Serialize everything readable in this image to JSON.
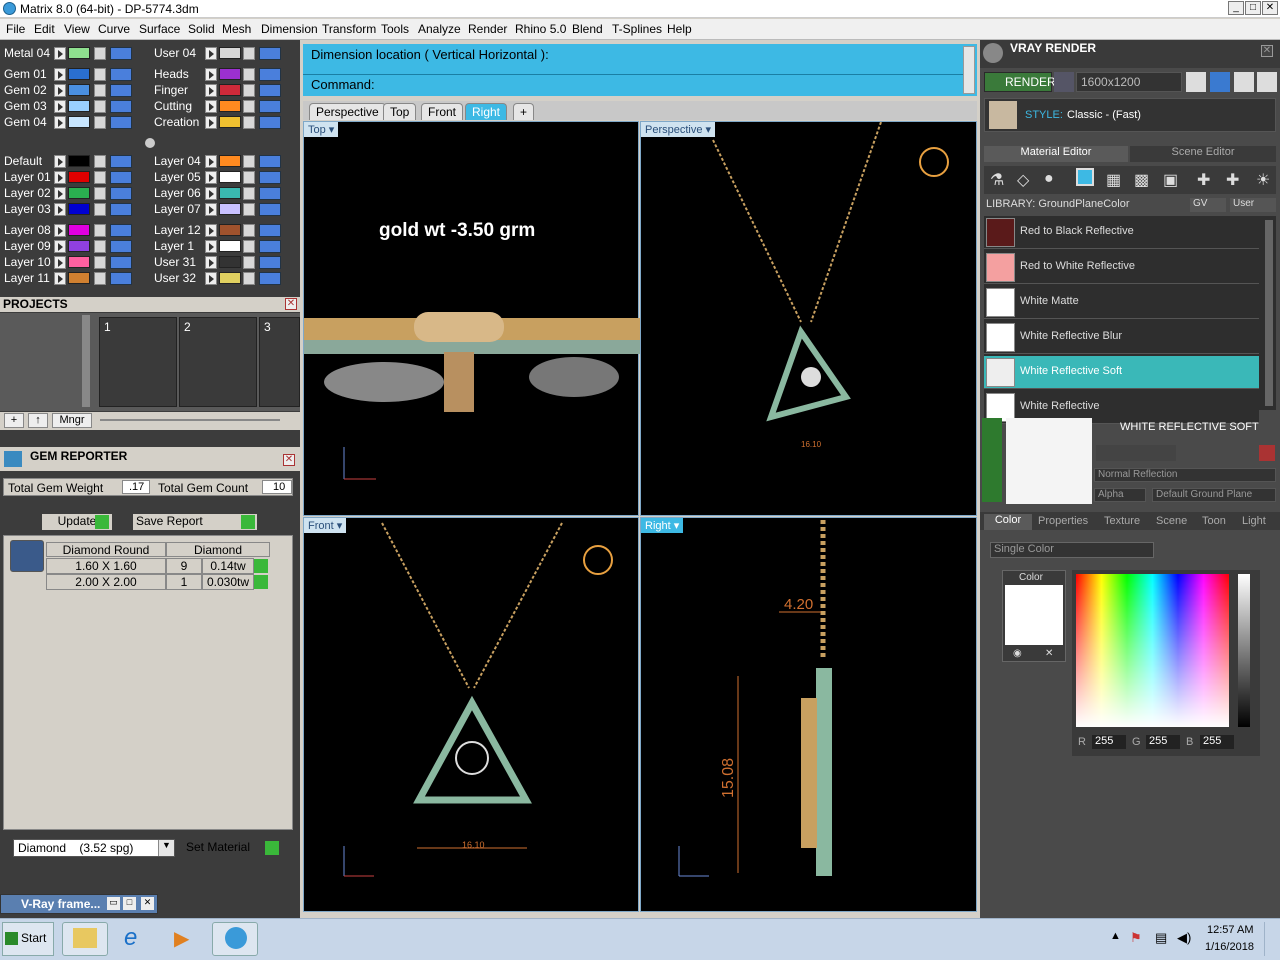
{
  "window": {
    "title": "Matrix 8.0 (64-bit) - DP-5774.3dm"
  },
  "menu": [
    "File",
    "Edit",
    "View",
    "Curve",
    "Surface",
    "Solid",
    "Mesh",
    "Dimension",
    "Transform",
    "Tools",
    "Analyze",
    "Render",
    "Rhino 5.0",
    "Blend",
    "T-Splines",
    "Help"
  ],
  "layers_top": [
    {
      "name": "Metal 04",
      "color": "#8fe08f",
      "name2": "User 04",
      "color2": "#d8d8d8"
    },
    {
      "name": "Gem 01",
      "color": "#2a6fd0",
      "name2": "Heads",
      "color2": "#9b30d0"
    },
    {
      "name": "Gem 02",
      "color": "#4a8fe0",
      "name2": "Finger",
      "color2": "#d02a3a"
    },
    {
      "name": "Gem 03",
      "color": "#9ad0ff",
      "name2": "Cutting",
      "color2": "#ff8a20"
    },
    {
      "name": "Gem 04",
      "color": "#c8e6ff",
      "name2": "Creation",
      "color2": "#f0c030"
    }
  ],
  "layers_bottom": [
    {
      "name": "Default",
      "color": "#000000",
      "name2": "Layer 04",
      "color2": "#ff8a20"
    },
    {
      "name": "Layer 01",
      "color": "#e00000",
      "name2": "Layer 05",
      "color2": "#ffffff"
    },
    {
      "name": "Layer 02",
      "color": "#2ab050",
      "name2": "Layer 06",
      "color2": "#3ab8b0"
    },
    {
      "name": "Layer 03",
      "color": "#0000d0",
      "name2": "Layer 07",
      "color2": "#c8c0ff"
    },
    {
      "name": "Layer 08",
      "color": "#e000e0",
      "name2": "Layer 12",
      "color2": "#a0522d"
    },
    {
      "name": "Layer 09",
      "color": "#9040e0",
      "name2": "Layer 1",
      "color2": "#ffffff"
    },
    {
      "name": "Layer 10",
      "color": "#ff60a0",
      "name2": "User 31",
      "color2": "#333333"
    },
    {
      "name": "Layer 11",
      "color": "#d08030",
      "name2": "User 32",
      "color2": "#e0d060"
    }
  ],
  "projects": {
    "title": "PROJECTS",
    "slots": [
      "1",
      "2",
      "3"
    ],
    "mngr": "Mngr"
  },
  "gem_reporter": {
    "title": "GEM REPORTER",
    "total_weight_label": "Total Gem Weight",
    "total_weight": ".17",
    "total_count_label": "Total Gem Count",
    "total_count": "10",
    "update": "Update",
    "save": "Save Report",
    "header": [
      "Diamond Round",
      "Diamond"
    ],
    "rows": [
      [
        "1.60 X 1.60",
        "9",
        "0.14tw"
      ],
      [
        "2.00 X 2.00",
        "1",
        "0.030tw"
      ]
    ],
    "material": "Diamond    (3.52 spg)",
    "set_material": "Set Material"
  },
  "command": {
    "prompt": "Dimension location ( Vertical  Horizontal ):",
    "label": "Command:"
  },
  "tabs": [
    "Perspective",
    "Top",
    "Front",
    "Right"
  ],
  "viewports": {
    "top": {
      "label": "Top",
      "note": "gold wt -3.50 grm"
    },
    "persp": {
      "label": "Perspective",
      "dim": "16.10"
    },
    "front": {
      "label": "Front",
      "dim": "16.10"
    },
    "right": {
      "label": "Right",
      "dim1": "4.20",
      "dim2": "15.08"
    }
  },
  "vray": {
    "title": "VRAY RENDER",
    "render": "RENDER",
    "resolution": "1600x1200",
    "style_label": "STYLE:",
    "style": "Classic - (Fast)",
    "tab_mat": "Material Editor",
    "tab_scene": "Scene Editor",
    "library": "LIBRARY: GroundPlaneColor",
    "gv": "GV",
    "user": "User",
    "materials": [
      {
        "name": "Red to Black Reflective",
        "color": "#5a1a1a"
      },
      {
        "name": "Red to White Reflective",
        "color": "#f4a0a0"
      },
      {
        "name": "White Matte",
        "color": "#ffffff"
      },
      {
        "name": "White Reflective Blur",
        "color": "#ffffff"
      },
      {
        "name": "White Reflective Soft",
        "color": "#eeeeee"
      },
      {
        "name": "White Reflective",
        "color": "#ffffff"
      }
    ],
    "selected_title": "WHITE REFLECTIVE SOFT",
    "reflection": "Normal Reflection",
    "alpha": "Alpha",
    "ground": "Default Ground Plane",
    "ptabs": [
      "Color",
      "Properties",
      "Texture",
      "Scene",
      "Toon",
      "Light"
    ],
    "color_mode": "Single Color",
    "color_label": "Color",
    "r_label": "R",
    "r": "255",
    "g_label": "G",
    "g": "255",
    "b_label": "B",
    "b": "255"
  },
  "vray_frame": "V-Ray frame...",
  "taskbar": {
    "start": "Start",
    "time": "12:57 AM",
    "date": "1/16/2018"
  }
}
